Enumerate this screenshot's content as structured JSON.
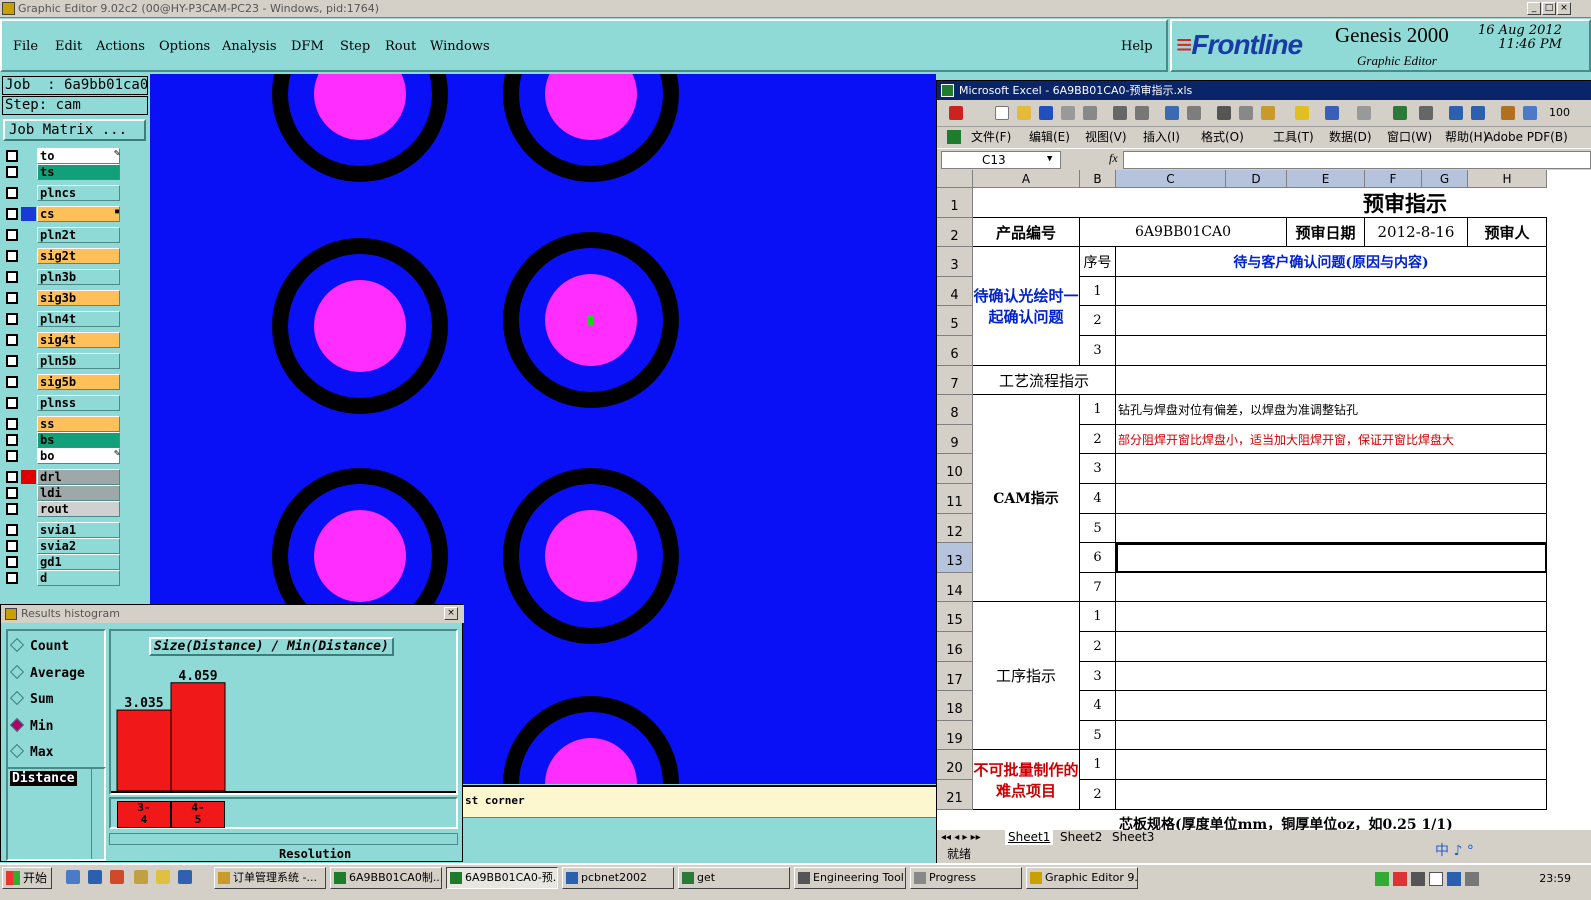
{
  "window": {
    "title": "Graphic Editor 9.02c2 (00@HY-P3CAM-PC23 - Windows, pid:1764)"
  },
  "menus": [
    "File",
    "Edit",
    "Actions",
    "Options",
    "Analysis",
    "DFM",
    "Step",
    "Rout",
    "Windows"
  ],
  "help_label": "Help",
  "brand": {
    "logo": "Frontline",
    "product": "Genesis 2000",
    "module": "Graphic Editor",
    "date": "16 Aug 2012",
    "time": "11:46 PM"
  },
  "job": {
    "job_label": "Job  : 6a9bb01ca0",
    "step_label": "Step: cam",
    "matrix_button": "Job Matrix ..."
  },
  "layers": [
    {
      "name": "to",
      "color": "#ffffff",
      "mark": "✎"
    },
    {
      "name": "ts",
      "color": "#11a07a",
      "mark": ""
    },
    {
      "name": "plncs",
      "color": "#8fdad6",
      "mark": ""
    },
    {
      "name": "cs",
      "color": "#ffc05a",
      "mark": "▪",
      "active": true
    },
    {
      "name": "pln2t",
      "color": "#8fdad6",
      "mark": ""
    },
    {
      "name": "sig2t",
      "color": "#ffc05a",
      "mark": ""
    },
    {
      "name": "pln3b",
      "color": "#8fdad6",
      "mark": ""
    },
    {
      "name": "sig3b",
      "color": "#ffc05a",
      "mark": ""
    },
    {
      "name": "pln4t",
      "color": "#8fdad6",
      "mark": ""
    },
    {
      "name": "sig4t",
      "color": "#ffc05a",
      "mark": ""
    },
    {
      "name": "pln5b",
      "color": "#8fdad6",
      "mark": ""
    },
    {
      "name": "sig5b",
      "color": "#ffc05a",
      "mark": ""
    },
    {
      "name": "plnss",
      "color": "#8fdad6",
      "mark": ""
    },
    {
      "name": "ss",
      "color": "#ffc05a",
      "mark": ""
    },
    {
      "name": "bs",
      "color": "#11a07a",
      "mark": ""
    },
    {
      "name": "bo",
      "color": "#ffffff",
      "mark": "✎"
    },
    {
      "name": "drl",
      "color": "#9fa8a8",
      "mark": "",
      "swatch": "#e00000"
    },
    {
      "name": "ldi",
      "color": "#9fa8a8",
      "mark": ""
    },
    {
      "name": "rout",
      "color": "#d0d0d0",
      "mark": ""
    },
    {
      "name": "svia1",
      "color": "#8fdad6",
      "mark": ""
    },
    {
      "name": "svia2",
      "color": "#8fdad6",
      "mark": ""
    },
    {
      "name": "gd1",
      "color": "#8fdad6",
      "mark": ""
    },
    {
      "name": "d",
      "color": "#8fdad6",
      "mark": ""
    }
  ],
  "histogram": {
    "window_title": "Results histogram",
    "modes": [
      "Count",
      "Average",
      "Sum",
      "Min",
      "Max"
    ],
    "selected_mode": "Min",
    "list_item": "Distance",
    "resolution_label": "Resolution"
  },
  "chart_data": {
    "type": "bar",
    "title": "Size(Distance) / Min(Distance)",
    "categories": [
      "3-\n4",
      "4-\n5"
    ],
    "values": [
      3.035,
      4.059
    ],
    "value_labels": [
      "3.035",
      "4.059"
    ],
    "ylim": [
      0,
      4.5
    ],
    "bar_color": "#f01818",
    "grid": false
  },
  "status_text": "st corner",
  "excel": {
    "title": "Microsoft Excel - 6A9BB01CA0-预审指示.xls",
    "menus": [
      "文件(F)",
      "编辑(E)",
      "视图(V)",
      "插入(I)",
      "格式(O)",
      "工具(T)",
      "数据(D)",
      "窗口(W)",
      "帮助(H)",
      "Adobe PDF(B)"
    ],
    "zoom": "100",
    "name_box": "C13",
    "fx": "fx",
    "columns": [
      "A",
      "B",
      "C",
      "D",
      "E",
      "F",
      "G",
      "H"
    ],
    "rows": [
      "1",
      "2",
      "3",
      "4",
      "5",
      "6",
      "7",
      "8",
      "9",
      "10",
      "11",
      "12",
      "13",
      "14",
      "15",
      "16",
      "17",
      "18",
      "19",
      "20",
      "21"
    ],
    "cells": {
      "title": "预审指示",
      "product_no_label": "产品编号",
      "product_no": "6A9BB01CA0",
      "review_date_label": "预审日期",
      "review_date": "2012-8-16",
      "reviewer_label": "预审人",
      "seq_label": "序号",
      "confirm_header": "待与客户确认问题(原因与内容)",
      "confirm_group": "待确认光绘时一起确认问题",
      "process_label": "工艺流程指示",
      "cam_label": "CAM指示",
      "cam_note_1": "钻孔与焊盘对位有偏差，以焊盘为准调整钻孔",
      "cam_note_2": "部分阻焊开窗比焊盘小，适当加大阻焊开窗，保证开窗比焊盘大",
      "procedure_label": "工序指示",
      "difficulty_label": "不可批量制作的难点项目",
      "spec_label": "芯板规格(厚度单位mm，铜厚单位oz，如0.25 1/1)",
      "seq_confirm": [
        "1",
        "2",
        "3"
      ],
      "seq_cam": [
        "1",
        "2",
        "3",
        "4",
        "5",
        "6",
        "7"
      ],
      "seq_proc": [
        "1",
        "2",
        "3",
        "4",
        "5"
      ],
      "seq_diff": [
        "1",
        "2"
      ]
    },
    "sheets": [
      "Sheet1",
      "Sheet2",
      "Sheet3"
    ],
    "status": "就绪"
  },
  "taskbar": {
    "start": "开始",
    "tasks": [
      "订单管理系统 -...",
      "6A9BB01CA0制...",
      "6A9BB01CA0-预...",
      "pcbnet2002",
      "get",
      "Engineering Tool...",
      "Progress",
      "Graphic Editor 9..."
    ],
    "clock": "23:59",
    "ime": "中 ♪ °"
  }
}
